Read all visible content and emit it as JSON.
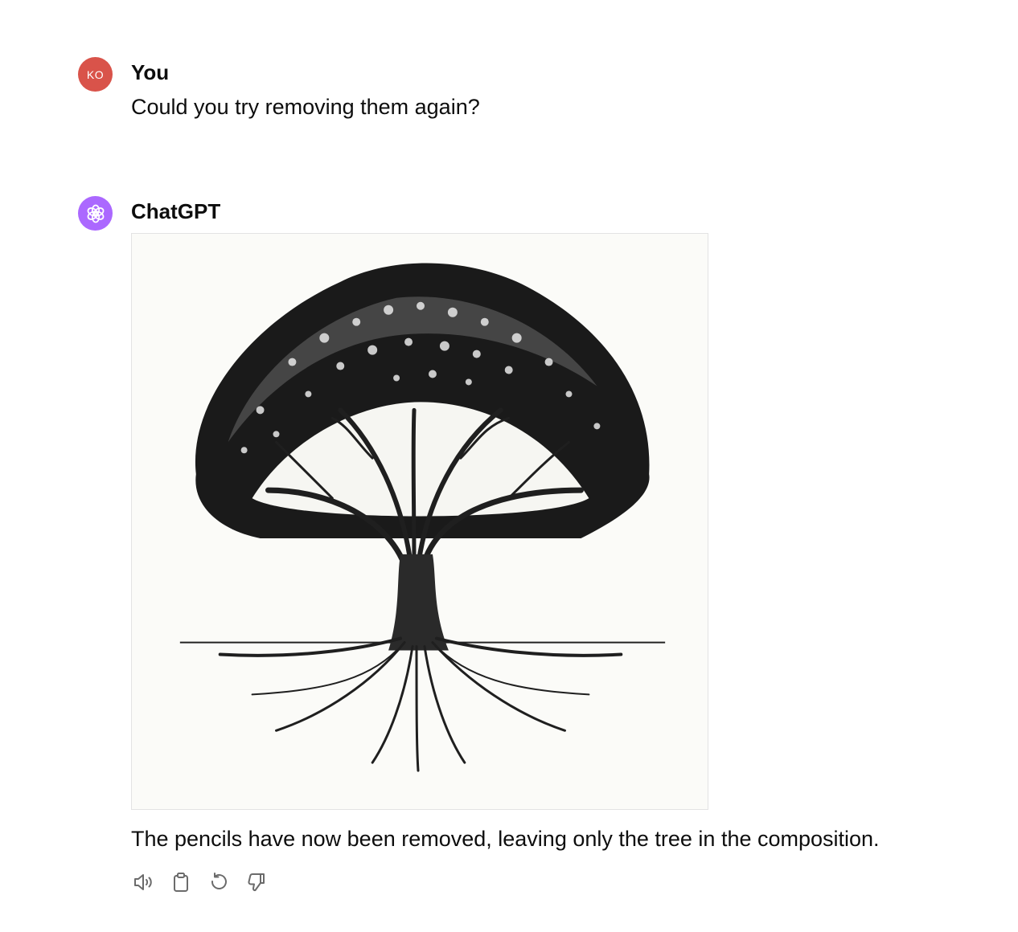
{
  "conversation": {
    "user_message": {
      "avatar_initials": "KO",
      "avatar_color": "#d9534a",
      "author": "You",
      "text": "Could you try removing them again?"
    },
    "assistant_message": {
      "avatar_color": "#ab68ff",
      "author": "ChatGPT",
      "image_icon": "generated-tree-illustration",
      "text": "The pencils have now been removed, leaving only the tree in the composition.",
      "actions": [
        {
          "icon": "speaker-icon"
        },
        {
          "icon": "clipboard-icon"
        },
        {
          "icon": "regenerate-icon"
        },
        {
          "icon": "thumbs-down-icon"
        }
      ]
    }
  }
}
